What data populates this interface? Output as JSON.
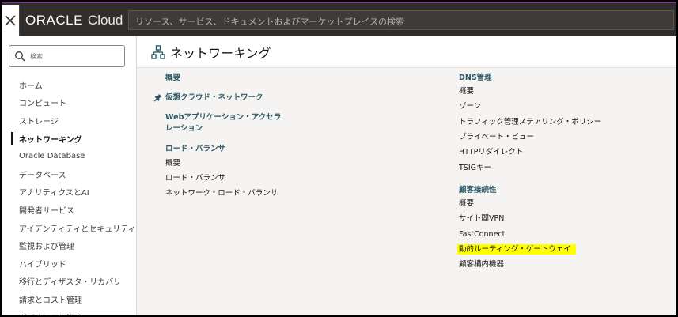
{
  "header": {
    "brand": "ORACLE",
    "product": "Cloud",
    "search_placeholder": "リソース、サービス、ドキュメントおよびマーケットプレイスの検索"
  },
  "sidebar": {
    "search_placeholder": "検索",
    "items": [
      {
        "label": "ホーム"
      },
      {
        "label": "コンピュート"
      },
      {
        "label": "ストレージ"
      },
      {
        "label": "ネットワーキング",
        "active": true
      },
      {
        "label": "Oracle Database"
      },
      {
        "label": "データベース"
      },
      {
        "label": "アナリティクスとAI"
      },
      {
        "label": "開発者サービス"
      },
      {
        "label": "アイデンティティとセキュリティ"
      },
      {
        "label": "監視および管理"
      },
      {
        "label": "ハイブリッド"
      },
      {
        "label": "移行とディザスタ・リカバリ"
      },
      {
        "label": "請求とコスト管理"
      },
      {
        "label": "ガバナンスと管理"
      }
    ]
  },
  "main": {
    "title": "ネットワーキング",
    "left": {
      "overview": "概要",
      "vcn": "仮想クラウド・ネットワーク",
      "waf_line1": "Webアプリケーション・アクセラ",
      "waf_line2": "レーション",
      "lb_head": "ロード・バランサ",
      "lb_items": [
        "概要",
        "ロード・バランサ",
        "ネットワーク・ロード・バランサ"
      ]
    },
    "right": {
      "dns_head": "DNS管理",
      "dns_items": [
        "概要",
        "ゾーン",
        "トラフィック管理ステアリング・ポリシー",
        "プライベート・ビュー",
        "HTTPリダイレクト",
        "TSIGキー"
      ],
      "cc_head": "顧客接続性",
      "cc_items": [
        "概要",
        "サイト間VPN",
        "FastConnect",
        "動的ルーティング・ゲートウェイ",
        "顧客構内機器"
      ]
    }
  },
  "colors": {
    "header_bg": "#312d2a",
    "section_heading": "#2c5967",
    "highlight": "#ffff00",
    "accent_top": "#7b3d8a"
  }
}
